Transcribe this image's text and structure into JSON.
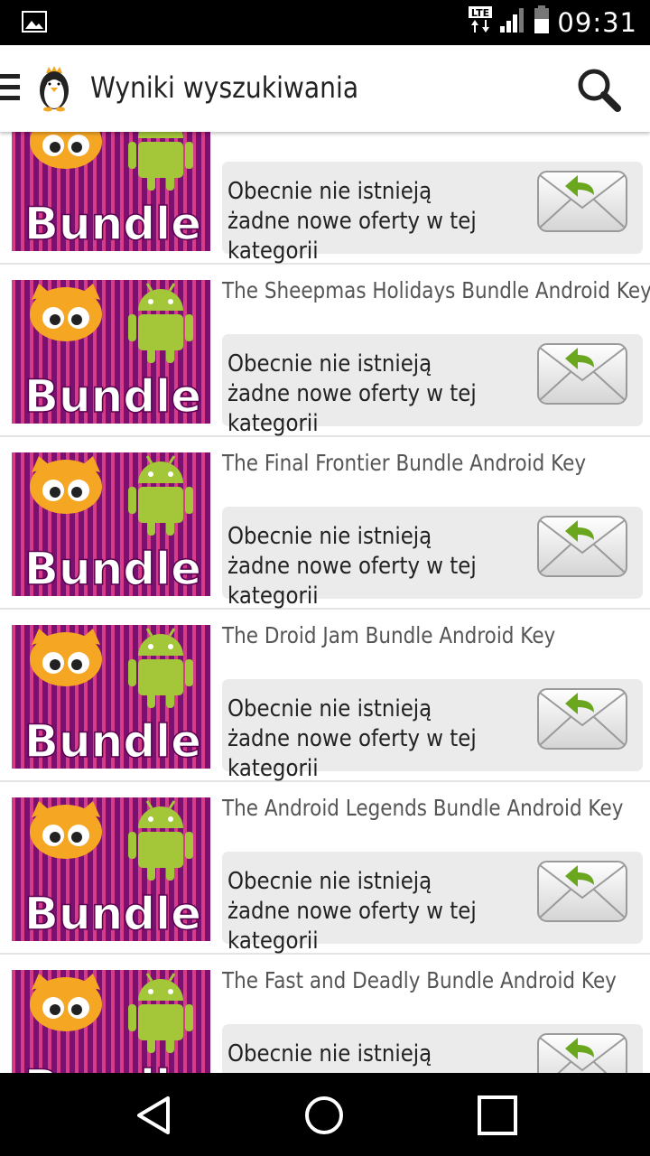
{
  "status_bar": {
    "time": "09:31",
    "network": "LTE",
    "icons": [
      "image-notification-icon",
      "lte-icon",
      "signal-icon",
      "battery-icon"
    ]
  },
  "app_bar": {
    "title": "Wyniki wyszukiwania",
    "icons": [
      "menu-icon",
      "penguin-logo-icon",
      "search-icon"
    ]
  },
  "thumbnail": {
    "label": "Bundle"
  },
  "products": [
    {
      "title": "",
      "offer_text": "Obecnie nie istnieją żadne nowe oferty w tej kategorii"
    },
    {
      "title": "The Sheepmas Holidays Bundle Android Key",
      "offer_text": "Obecnie nie istnieją żadne nowe oferty w tej kategorii"
    },
    {
      "title": "The Final Frontier Bundle Android Key",
      "offer_text": "Obecnie nie istnieją żadne nowe oferty w tej kategorii"
    },
    {
      "title": "The Droid Jam Bundle Android Key",
      "offer_text": "Obecnie nie istnieją żadne nowe oferty w tej kategorii"
    },
    {
      "title": "The Android Legends Bundle Android Key",
      "offer_text": "Obecnie nie istnieją żadne nowe oferty w tej kategorii"
    },
    {
      "title": "The Fast and Deadly Bundle Android Key",
      "offer_text": "Obecnie nie istnieją żadne nowe oferty w tej kategorii"
    }
  ],
  "nav_bar": {
    "icons": [
      "back-icon",
      "home-icon",
      "recents-icon"
    ]
  },
  "colors": {
    "thumb_stripe_a": "#7a1070",
    "thumb_stripe_b": "#d63c87",
    "owl": "#f5a623",
    "android_green": "#a4c639",
    "reply_arrow": "#6aa61e",
    "offer_box": "#ebebeb"
  }
}
